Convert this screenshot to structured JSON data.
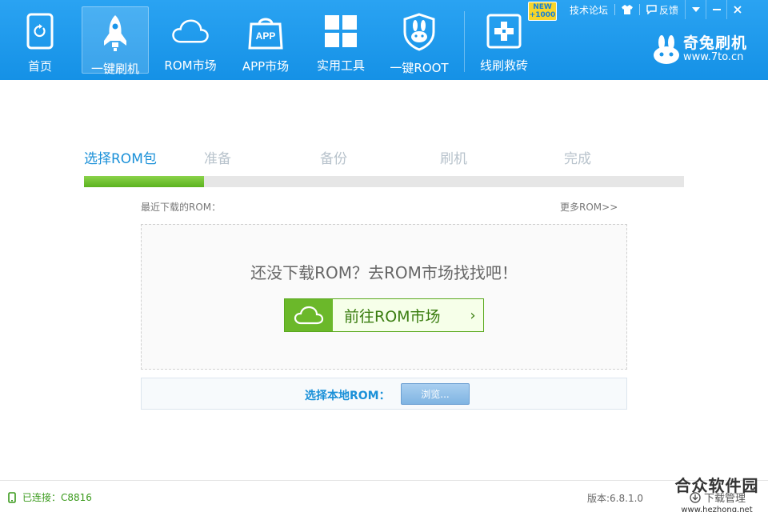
{
  "nav": {
    "items": [
      {
        "label": "首页",
        "icon": "phone-refresh-icon"
      },
      {
        "label": "一键刷机",
        "icon": "rocket-icon"
      },
      {
        "label": "ROM市场",
        "icon": "cloud-icon"
      },
      {
        "label": "APP市场",
        "icon": "app-bag-icon"
      },
      {
        "label": "实用工具",
        "icon": "grid-icon"
      },
      {
        "label": "一键ROOT",
        "icon": "rabbit-shield-icon"
      },
      {
        "label": "线刷救砖",
        "icon": "medical-cross-icon"
      }
    ],
    "active_index": 1
  },
  "badge": {
    "line1": "NEW",
    "line2": "+1000"
  },
  "top_links": {
    "forum": "技术论坛",
    "feedback": "反馈"
  },
  "brand": {
    "name": "奇兔刷机",
    "url": "www.7to.cn"
  },
  "steps": {
    "items": [
      "选择ROM包",
      "准备",
      "备份",
      "刷机",
      "完成"
    ],
    "current_index": 0,
    "progress": 0.2
  },
  "recent": {
    "label": "最近下载的ROM：",
    "more": "更多ROM>>"
  },
  "empty": {
    "message": "还没下载ROM？去ROM市场找找吧！",
    "button": "前往ROM市场",
    "arrow": "›"
  },
  "local": {
    "label": "选择本地ROM：",
    "browse": "浏览..."
  },
  "status": {
    "connected": "已连接：C8816",
    "version": "版本:6.8.1.0",
    "download_manager": "下载管理"
  },
  "watermark": {
    "title": "合众软件园",
    "url": "www.hezhong.net"
  },
  "colors": {
    "header": "#1a96ea",
    "accent": "#1a90d8",
    "green": "#6bb82a",
    "connected": "#3a9a1c"
  }
}
